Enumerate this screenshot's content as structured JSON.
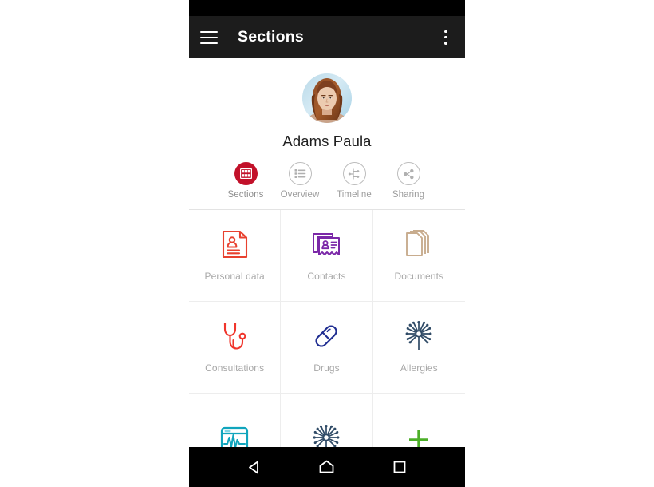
{
  "appbar": {
    "title": "Sections",
    "menu_icon": "hamburger-menu-icon",
    "overflow_icon": "overflow-menu-icon"
  },
  "profile": {
    "name": "Adams Paula",
    "avatar_alt": "user-avatar-photo",
    "avatar_bg": "#cfe7f2"
  },
  "tabs": [
    {
      "label": "Sections",
      "icon": "grid-icon",
      "active": true,
      "color": "#c2112a"
    },
    {
      "label": "Overview",
      "icon": "list-icon",
      "active": false,
      "color": "#bdbdbd"
    },
    {
      "label": "Timeline",
      "icon": "timeline-icon",
      "active": false,
      "color": "#bdbdbd"
    },
    {
      "label": "Sharing",
      "icon": "share-icon",
      "active": false,
      "color": "#bdbdbd"
    }
  ],
  "sections": [
    {
      "label": "Personal data",
      "icon": "personal-data-icon",
      "color": "#e8412f"
    },
    {
      "label": "Contacts",
      "icon": "contacts-card-icon",
      "color": "#7b28a8"
    },
    {
      "label": "Documents",
      "icon": "documents-icon",
      "color": "#c8ac8e"
    },
    {
      "label": "Consultations",
      "icon": "stethoscope-icon",
      "color": "#f0352c"
    },
    {
      "label": "Drugs",
      "icon": "pill-capsule-icon",
      "color": "#1f2d91"
    },
    {
      "label": "Allergies",
      "icon": "pollen-burst-icon",
      "color": "#2f4a66"
    },
    {
      "label": "",
      "icon": "vitals-monitor-icon",
      "color": "#10a5bd"
    },
    {
      "label": "",
      "icon": "pollen-burst-icon",
      "color": "#2f4a66"
    },
    {
      "label": "",
      "icon": "add-plus-icon",
      "color": "#4caf28"
    }
  ],
  "navbar": {
    "back_label": "Back",
    "home_label": "Home",
    "recents_label": "Recent apps"
  }
}
